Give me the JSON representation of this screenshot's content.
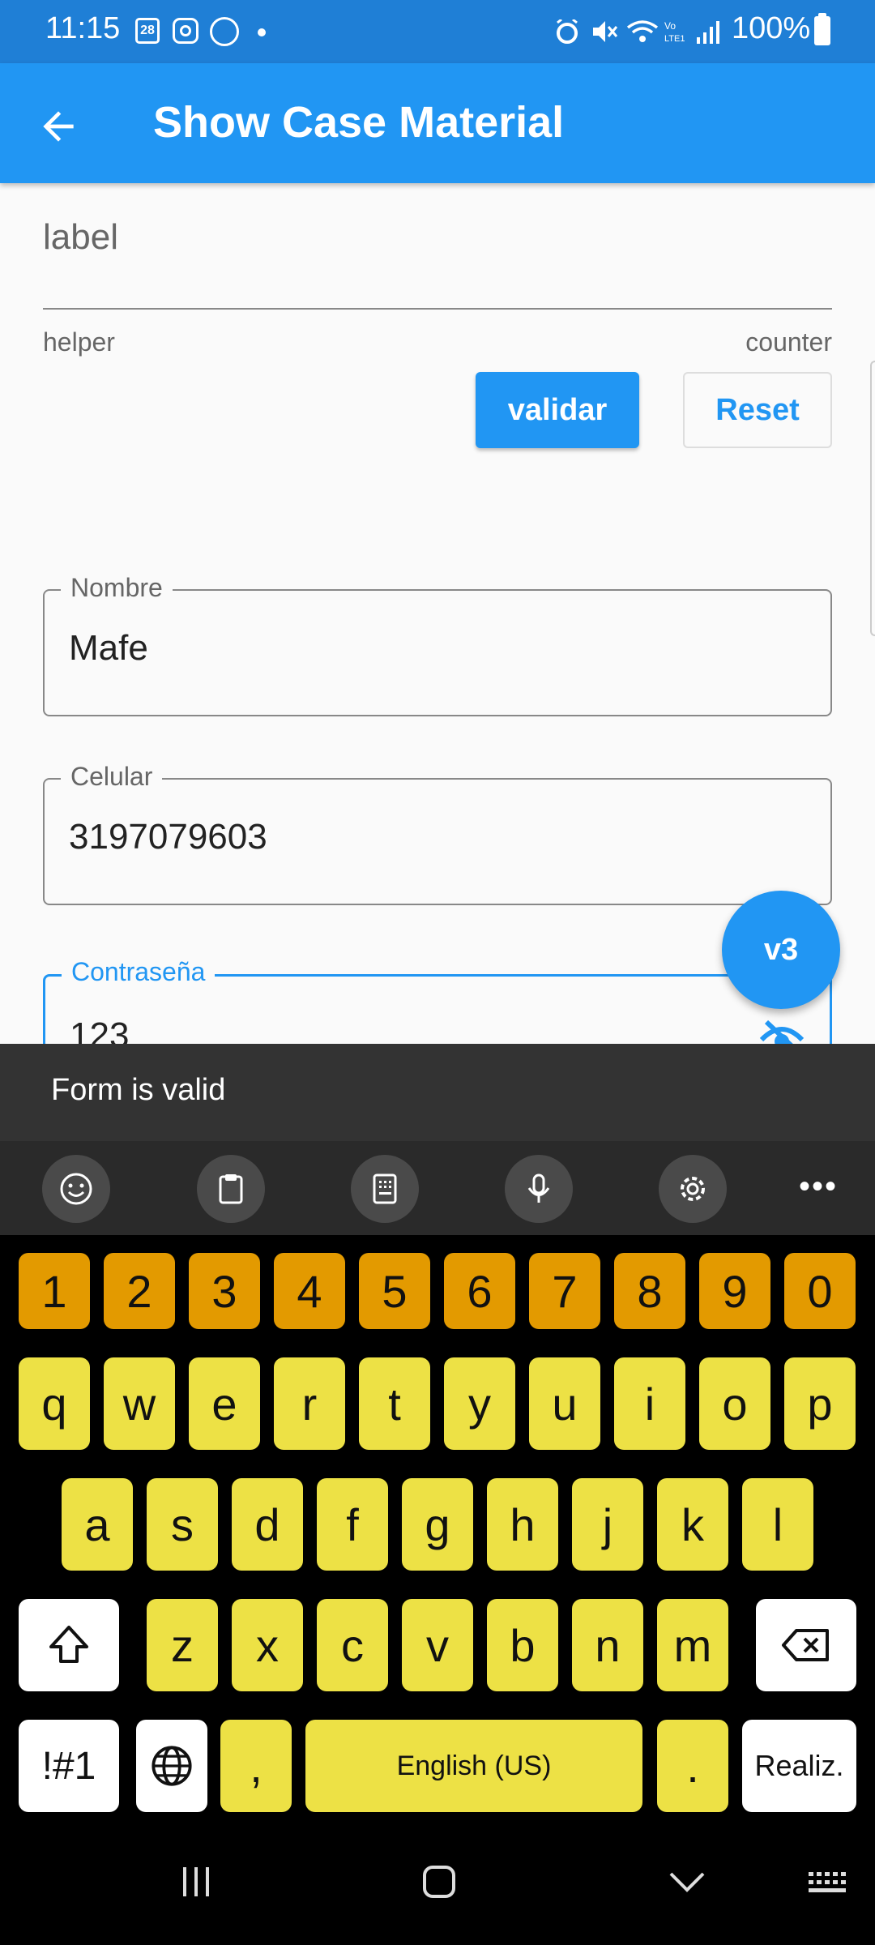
{
  "status_bar": {
    "time": "11:15",
    "calendar_day": "28",
    "battery": "100%"
  },
  "app_bar": {
    "title": "Show Case Material"
  },
  "form": {
    "label_field": {
      "label": "label",
      "helper": "helper",
      "counter": "counter"
    },
    "validate_label": "validar",
    "reset_label": "Reset",
    "name_field": {
      "label": "Nombre",
      "value": "Mafe"
    },
    "phone_field": {
      "label": "Celular",
      "value": "3197079603"
    },
    "password_field": {
      "label": "Contraseña",
      "value": "123"
    },
    "fab_label": "v3"
  },
  "snackbar": {
    "message": "Form is valid"
  },
  "keyboard": {
    "numbers": [
      "1",
      "2",
      "3",
      "4",
      "5",
      "6",
      "7",
      "8",
      "9",
      "0"
    ],
    "row1": [
      "q",
      "w",
      "e",
      "r",
      "t",
      "y",
      "u",
      "i",
      "o",
      "p"
    ],
    "row2": [
      "a",
      "s",
      "d",
      "f",
      "g",
      "h",
      "j",
      "k",
      "l"
    ],
    "row3": [
      "z",
      "x",
      "c",
      "v",
      "b",
      "n",
      "m"
    ],
    "symbols_key": "!#1",
    "comma_key": ",",
    "space_label": "English (US)",
    "period_key": ".",
    "action_key": "Realiz.",
    "colors": {
      "number_keys": "#e39a00",
      "letter_keys": "#ede145",
      "background": "#000000"
    }
  },
  "colors": {
    "primary": "#2196f3",
    "status_bar": "#1f7fd6",
    "snackbar": "#333333"
  }
}
